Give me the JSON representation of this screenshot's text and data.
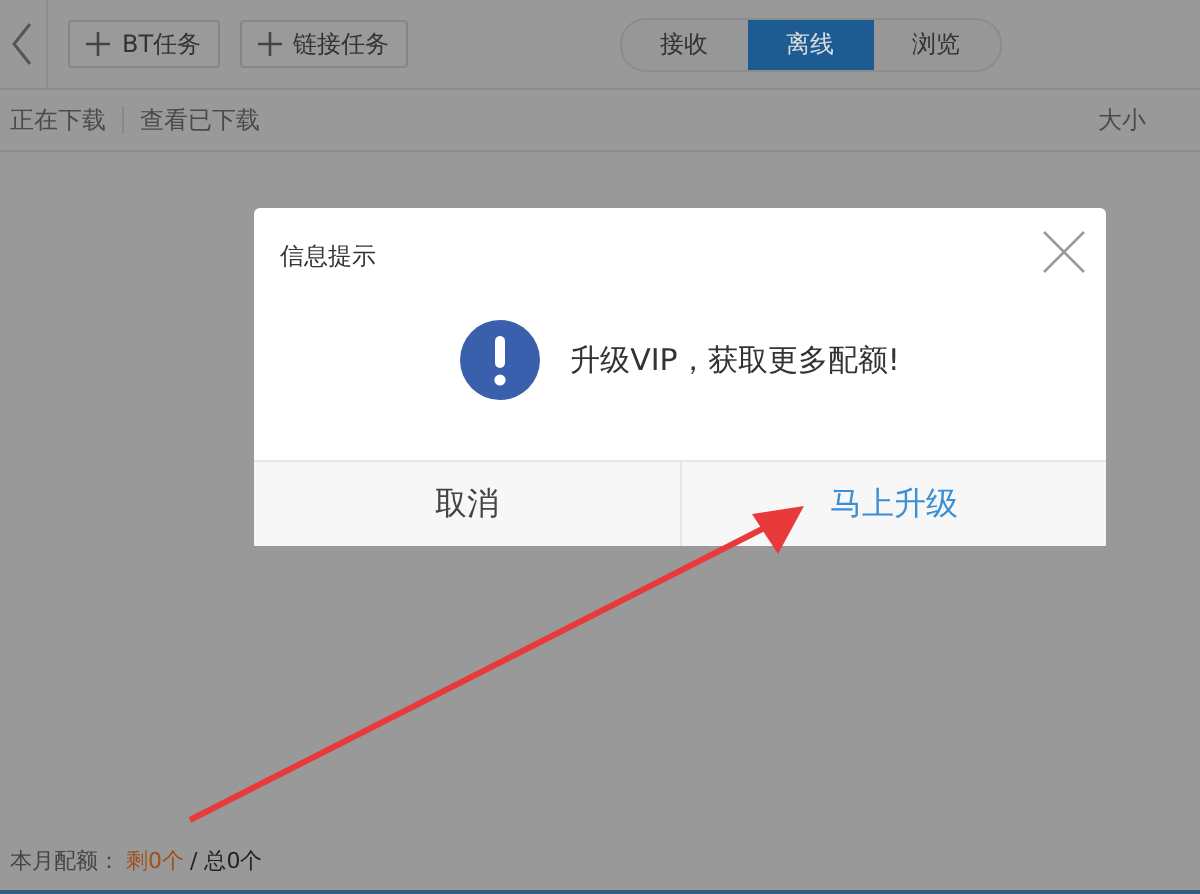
{
  "toolbar": {
    "buttons": [
      {
        "label": "BT任务"
      },
      {
        "label": "链接任务"
      }
    ],
    "tabs": [
      {
        "label": "接收",
        "selected": false
      },
      {
        "label": "离线",
        "selected": true
      },
      {
        "label": "浏览",
        "selected": false
      }
    ]
  },
  "list_header": {
    "links": [
      "正在下载",
      "查看已下载"
    ],
    "column_size": "大小"
  },
  "status_bar": {
    "label": "本月配额：",
    "remaining": "剩0个",
    "total": "/ 总0个"
  },
  "dialog": {
    "title": "信息提示",
    "message": "升级VIP，获取更多配额!",
    "buttons": [
      {
        "label": "取消",
        "kind": "cancel"
      },
      {
        "label": "马上升级",
        "kind": "primary"
      }
    ]
  }
}
